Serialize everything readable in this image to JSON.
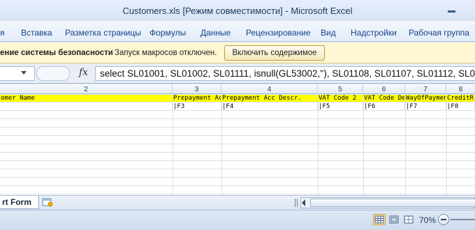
{
  "window": {
    "title": "Customers.xls  [Режим совместимости]  -  Microsoft Excel"
  },
  "ribbon": {
    "tabs": [
      "я",
      "Вставка",
      "Разметка страницы",
      "Формулы",
      "Данные",
      "Рецензирование",
      "Вид",
      "Надстройки",
      "Рабочая группа"
    ]
  },
  "security_bar": {
    "title": "ение системы безопасности",
    "message": "Запуск макросов отключен.",
    "enable_button": "Включить содержимое"
  },
  "formula_bar": {
    "fx_label": "fx",
    "formula": "select SL01001, SL01002, SL01111, isnull(GL53002,''), SL01108, SL01107, SL01112, SL01"
  },
  "columns": [
    "2",
    "3",
    "4",
    "5",
    "6",
    "7",
    "8"
  ],
  "rows": {
    "header": [
      "omer Name",
      "Prepayment Acc",
      "Prepayment Acc Descr.",
      "VAT Code 2",
      "VAT Code Des",
      "WayOfPayment",
      "CreditR"
    ],
    "fields": [
      "",
      "|F3",
      "|F4",
      "|F5",
      "|F6",
      "|F7",
      "|F8"
    ]
  },
  "sheets": {
    "active": "rt Form"
  },
  "status": {
    "zoom": "70%"
  },
  "colors": {
    "header_row": "#ffff00",
    "security_bar": "#fff6d2"
  }
}
